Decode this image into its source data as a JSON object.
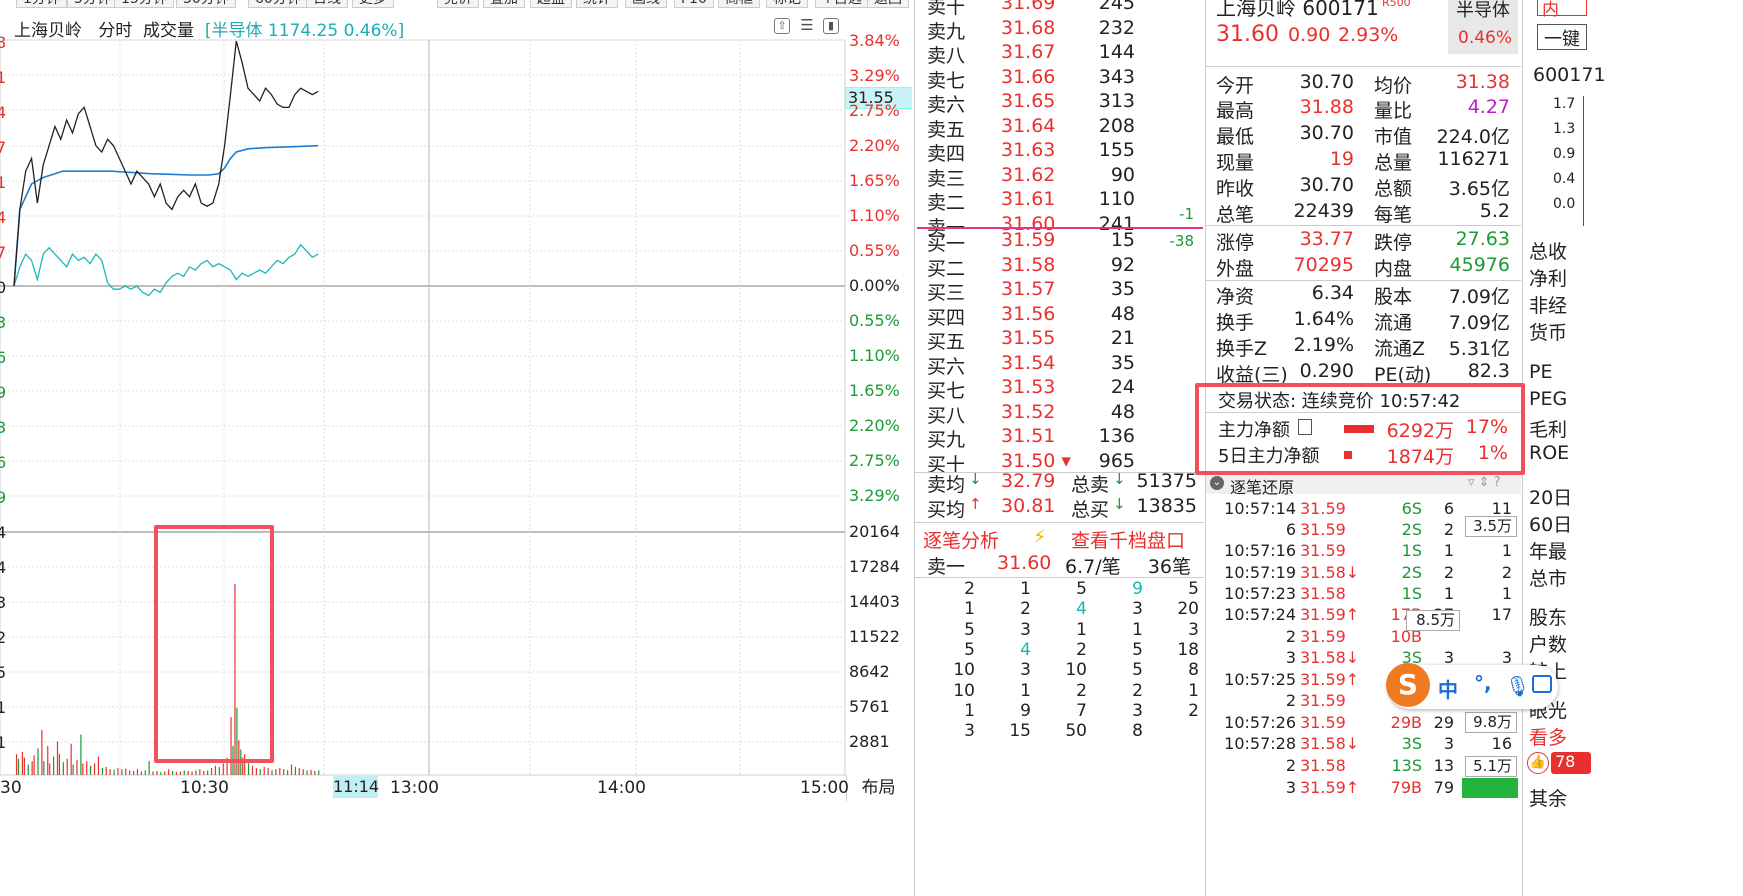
{
  "tabs": [
    "1分钟",
    "5分钟",
    "15分钟",
    "30分钟",
    "60分钟",
    "日线",
    "更多",
    "竞价",
    "叠加",
    "超盘",
    "统计",
    "画线",
    "F10",
    "商框",
    "标记",
    "+自选",
    "返回"
  ],
  "chart": {
    "stock_name": "上海贝岭",
    "mode": "分时",
    "indicator": "成交量",
    "sector_badge": "[半导体 1174.25 0.46%]",
    "left_axis": [
      "8",
      "1",
      "4",
      "7",
      "1",
      "4",
      "7",
      "0",
      "3",
      "6",
      "9",
      "3",
      "6",
      "9",
      "4",
      "4",
      "3",
      "2",
      "5",
      "1",
      "1"
    ],
    "pct_labels": [
      {
        "v": "3.84%",
        "c": "red"
      },
      {
        "v": "3.29%",
        "c": "red"
      },
      {
        "v": "2.75%",
        "c": "red"
      },
      {
        "v": "2.20%",
        "c": "red"
      },
      {
        "v": "1.65%",
        "c": "red"
      },
      {
        "v": "1.10%",
        "c": "red"
      },
      {
        "v": "0.55%",
        "c": "red"
      },
      {
        "v": "0.00%",
        "c": "dark"
      },
      {
        "v": "0.55%",
        "c": "green"
      },
      {
        "v": "1.10%",
        "c": "green"
      },
      {
        "v": "1.65%",
        "c": "green"
      },
      {
        "v": "2.20%",
        "c": "green"
      },
      {
        "v": "2.75%",
        "c": "green"
      },
      {
        "v": "3.29%",
        "c": "green"
      }
    ],
    "vol_labels": [
      "20164",
      "17284",
      "14403",
      "11522",
      "8642",
      "5761",
      "2881"
    ],
    "price_tag": "31.55",
    "time_labels": [
      "30",
      "10:30",
      "13:00",
      "14:00",
      "15:00"
    ],
    "cursor_time": "11:14",
    "layout_btn": "布局",
    "colors": {
      "price": "#222222",
      "avg": "#1a7fd4",
      "sector": "#1bb8b8",
      "up": "#e8312f",
      "down": "#1c9a36",
      "box": "#f0525d"
    },
    "price_series": [
      [
        0,
        0.0
      ],
      [
        3,
        1.2
      ],
      [
        6,
        1.8
      ],
      [
        9,
        2.0
      ],
      [
        12,
        1.3
      ],
      [
        15,
        1.9
      ],
      [
        18,
        2.2
      ],
      [
        21,
        2.5
      ],
      [
        24,
        2.3
      ],
      [
        27,
        2.6
      ],
      [
        30,
        2.4
      ],
      [
        33,
        2.7
      ],
      [
        36,
        2.8
      ],
      [
        39,
        2.5
      ],
      [
        42,
        2.2
      ],
      [
        45,
        2.1
      ],
      [
        48,
        2.3
      ],
      [
        51,
        2.2
      ],
      [
        54,
        2.0
      ],
      [
        57,
        1.8
      ],
      [
        60,
        1.6
      ],
      [
        63,
        1.8
      ],
      [
        66,
        1.7
      ],
      [
        69,
        1.6
      ],
      [
        72,
        1.4
      ],
      [
        75,
        1.6
      ],
      [
        78,
        1.3
      ],
      [
        81,
        1.2
      ],
      [
        84,
        1.4
      ],
      [
        87,
        1.5
      ],
      [
        90,
        1.4
      ],
      [
        93,
        1.6
      ],
      [
        96,
        1.3
      ],
      [
        99,
        1.25
      ],
      [
        102,
        1.3
      ],
      [
        105,
        1.6
      ],
      [
        108,
        2.2
      ],
      [
        111,
        3.0
      ],
      [
        114,
        3.84
      ],
      [
        117,
        3.5
      ],
      [
        120,
        3.1
      ],
      [
        123,
        3.0
      ],
      [
        126,
        2.9
      ],
      [
        129,
        3.1
      ],
      [
        132,
        3.0
      ],
      [
        135,
        2.85
      ],
      [
        138,
        2.8
      ],
      [
        141,
        2.8
      ],
      [
        144,
        3.0
      ],
      [
        147,
        3.1
      ],
      [
        150,
        3.05
      ],
      [
        153,
        3.0
      ],
      [
        156,
        3.05
      ]
    ],
    "avg_series": [
      [
        0,
        0.0
      ],
      [
        3,
        1.2
      ],
      [
        6,
        1.4
      ],
      [
        9,
        1.6
      ],
      [
        12,
        1.65
      ],
      [
        15,
        1.7
      ],
      [
        20,
        1.75
      ],
      [
        25,
        1.8
      ],
      [
        30,
        1.8
      ],
      [
        40,
        1.8
      ],
      [
        50,
        1.8
      ],
      [
        60,
        1.78
      ],
      [
        70,
        1.76
      ],
      [
        80,
        1.75
      ],
      [
        90,
        1.74
      ],
      [
        100,
        1.74
      ],
      [
        105,
        1.76
      ],
      [
        108,
        1.85
      ],
      [
        111,
        2.0
      ],
      [
        114,
        2.1
      ],
      [
        120,
        2.15
      ],
      [
        130,
        2.17
      ],
      [
        140,
        2.18
      ],
      [
        156,
        2.2
      ]
    ],
    "sector_series": [
      [
        0,
        0.0
      ],
      [
        3,
        0.3
      ],
      [
        6,
        0.5
      ],
      [
        9,
        0.4
      ],
      [
        12,
        0.1
      ],
      [
        15,
        0.5
      ],
      [
        18,
        0.6
      ],
      [
        21,
        0.5
      ],
      [
        24,
        0.4
      ],
      [
        27,
        0.3
      ],
      [
        30,
        0.5
      ],
      [
        33,
        0.4
      ],
      [
        36,
        0.45
      ],
      [
        39,
        0.35
      ],
      [
        42,
        0.5
      ],
      [
        45,
        0.4
      ],
      [
        48,
        0.05
      ],
      [
        51,
        -0.05
      ],
      [
        54,
        -0.05
      ],
      [
        57,
        0.0
      ],
      [
        60,
        -0.05
      ],
      [
        63,
        0.0
      ],
      [
        66,
        -0.1
      ],
      [
        69,
        -0.15
      ],
      [
        72,
        -0.05
      ],
      [
        75,
        -0.1
      ],
      [
        78,
        0.05
      ],
      [
        81,
        0.15
      ],
      [
        84,
        0.2
      ],
      [
        87,
        0.15
      ],
      [
        90,
        0.3
      ],
      [
        93,
        0.25
      ],
      [
        96,
        0.35
      ],
      [
        99,
        0.4
      ],
      [
        102,
        0.3
      ],
      [
        105,
        0.35
      ],
      [
        108,
        0.3
      ],
      [
        111,
        0.25
      ],
      [
        114,
        0.1
      ],
      [
        117,
        0.2
      ],
      [
        120,
        0.15
      ],
      [
        123,
        0.2
      ],
      [
        126,
        0.25
      ],
      [
        129,
        0.2
      ],
      [
        132,
        0.3
      ],
      [
        135,
        0.4
      ],
      [
        138,
        0.35
      ],
      [
        141,
        0.45
      ],
      [
        144,
        0.5
      ],
      [
        147,
        0.65
      ],
      [
        150,
        0.55
      ],
      [
        153,
        0.45
      ],
      [
        156,
        0.5
      ]
    ],
    "volume_bars": [
      [
        1,
        1800,
        1
      ],
      [
        2,
        1400,
        0
      ],
      [
        4,
        2000,
        1
      ],
      [
        5,
        1500,
        1
      ],
      [
        7,
        900,
        0
      ],
      [
        9,
        1200,
        1
      ],
      [
        10,
        1700,
        1
      ],
      [
        12,
        2300,
        0
      ],
      [
        14,
        3900,
        1
      ],
      [
        15,
        1200,
        0
      ],
      [
        17,
        2500,
        1
      ],
      [
        18,
        1000,
        1
      ],
      [
        20,
        1600,
        0
      ],
      [
        22,
        2900,
        1
      ],
      [
        23,
        1800,
        1
      ],
      [
        25,
        1100,
        0
      ],
      [
        27,
        1400,
        1
      ],
      [
        29,
        2700,
        1
      ],
      [
        30,
        900,
        0
      ],
      [
        32,
        1300,
        1
      ],
      [
        34,
        3500,
        0
      ],
      [
        35,
        1000,
        1
      ],
      [
        37,
        1200,
        1
      ],
      [
        39,
        800,
        0
      ],
      [
        41,
        1000,
        1
      ],
      [
        43,
        1600,
        1
      ],
      [
        45,
        600,
        0
      ],
      [
        47,
        700,
        1
      ],
      [
        49,
        500,
        1
      ],
      [
        51,
        450,
        0
      ],
      [
        53,
        600,
        1
      ],
      [
        55,
        500,
        0
      ],
      [
        57,
        550,
        1
      ],
      [
        59,
        400,
        1
      ],
      [
        61,
        350,
        0
      ],
      [
        63,
        500,
        1
      ],
      [
        65,
        300,
        1
      ],
      [
        67,
        400,
        0
      ],
      [
        69,
        1200,
        0
      ],
      [
        71,
        300,
        1
      ],
      [
        73,
        350,
        1
      ],
      [
        75,
        250,
        0
      ],
      [
        77,
        300,
        1
      ],
      [
        79,
        500,
        1
      ],
      [
        81,
        350,
        0
      ],
      [
        83,
        250,
        1
      ],
      [
        85,
        300,
        1
      ],
      [
        87,
        400,
        0
      ],
      [
        89,
        350,
        1
      ],
      [
        91,
        300,
        1
      ],
      [
        93,
        400,
        0
      ],
      [
        95,
        500,
        1
      ],
      [
        97,
        350,
        1
      ],
      [
        99,
        400,
        0
      ],
      [
        101,
        600,
        1
      ],
      [
        103,
        800,
        1
      ],
      [
        105,
        700,
        0
      ],
      [
        107,
        1000,
        1
      ],
      [
        109,
        1500,
        1
      ],
      [
        111,
        5000,
        1
      ],
      [
        112,
        2500,
        0
      ],
      [
        113,
        16500,
        1
      ],
      [
        114,
        5800,
        0
      ],
      [
        115,
        3000,
        1
      ],
      [
        116,
        2200,
        0
      ],
      [
        117,
        1500,
        1
      ],
      [
        118,
        1800,
        1
      ],
      [
        120,
        1000,
        0
      ],
      [
        122,
        800,
        1
      ],
      [
        124,
        600,
        1
      ],
      [
        126,
        500,
        0
      ],
      [
        128,
        700,
        1
      ],
      [
        130,
        600,
        1
      ],
      [
        132,
        400,
        0
      ],
      [
        134,
        500,
        1
      ],
      [
        136,
        600,
        1
      ],
      [
        138,
        500,
        0
      ],
      [
        140,
        400,
        1
      ],
      [
        142,
        900,
        1
      ],
      [
        144,
        700,
        0
      ],
      [
        146,
        600,
        1
      ],
      [
        148,
        500,
        1
      ],
      [
        150,
        400,
        0
      ],
      [
        152,
        450,
        1
      ],
      [
        154,
        350,
        1
      ],
      [
        156,
        400,
        0
      ]
    ]
  },
  "orderbook": {
    "sell": [
      [
        "卖十",
        "31.69",
        "245"
      ],
      [
        "卖九",
        "31.68",
        "232"
      ],
      [
        "卖八",
        "31.67",
        "144"
      ],
      [
        "卖七",
        "31.66",
        "343"
      ],
      [
        "卖六",
        "31.65",
        "313"
      ],
      [
        "卖五",
        "31.64",
        "208"
      ],
      [
        "卖四",
        "31.63",
        "155"
      ],
      [
        "卖三",
        "31.62",
        "90"
      ],
      [
        "卖二",
        "31.61",
        "110"
      ],
      [
        "卖一",
        "31.60",
        "241"
      ]
    ],
    "sell1_delta": "-1",
    "buy": [
      [
        "买一",
        "31.59",
        "15"
      ],
      [
        "买二",
        "31.58",
        "92"
      ],
      [
        "买三",
        "31.57",
        "35"
      ],
      [
        "买四",
        "31.56",
        "48"
      ],
      [
        "买五",
        "31.55",
        "21"
      ],
      [
        "买六",
        "31.54",
        "35"
      ],
      [
        "买七",
        "31.53",
        "24"
      ],
      [
        "买八",
        "31.52",
        "48"
      ],
      [
        "买九",
        "31.51",
        "136"
      ],
      [
        "买十",
        "31.50",
        "965"
      ]
    ],
    "buy1_delta": "-38",
    "sell_avg_label": "卖均",
    "sell_avg": "32.79",
    "total_sell_label": "总卖",
    "total_sell": "51375",
    "buy_avg_label": "买均",
    "buy_avg": "30.81",
    "total_buy_label": "总买",
    "total_buy": "13835",
    "tick_analysis": "逐笔分析",
    "view_depth": "查看千档盘口",
    "queue_label": "卖一",
    "queue_price": "31.60",
    "queue_per": "6.7/笔",
    "queue_count": "36笔",
    "queue": [
      [
        "2",
        "1",
        "5",
        "9",
        "5"
      ],
      [
        "1",
        "2",
        "4",
        "3",
        "20"
      ],
      [
        "5",
        "3",
        "1",
        "1",
        "3"
      ],
      [
        "5",
        "4",
        "2",
        "5",
        "18"
      ],
      [
        "10",
        "3",
        "10",
        "5",
        "8"
      ],
      [
        "10",
        "1",
        "2",
        "2",
        "1"
      ],
      [
        "1",
        "9",
        "7",
        "3",
        "2"
      ],
      [
        "3",
        "15",
        "50",
        "8",
        ""
      ]
    ]
  },
  "quote": {
    "name": "上海贝岭 600171",
    "r_badge": "R500",
    "price": "31.60",
    "change": "0.90",
    "pct": "2.93%",
    "sector": "半导体",
    "sector_pct": "0.46%",
    "rows": [
      [
        [
          "今开",
          "dark"
        ],
        [
          "30.70",
          "dark"
        ],
        [
          "均价",
          "dark"
        ],
        [
          "31.38",
          "red"
        ]
      ],
      [
        [
          "最高",
          "dark"
        ],
        [
          "31.88",
          "red"
        ],
        [
          "量比",
          "dark"
        ],
        [
          "4.27",
          "mag"
        ]
      ],
      [
        [
          "最低",
          "dark"
        ],
        [
          "30.70",
          "dark"
        ],
        [
          "市值",
          "dark"
        ],
        [
          "224.0亿",
          "dark"
        ]
      ],
      [
        [
          "现量",
          "dark"
        ],
        [
          "19",
          "red"
        ],
        [
          "总量",
          "dark"
        ],
        [
          "116271",
          "dark"
        ]
      ],
      [
        [
          "昨收",
          "dark"
        ],
        [
          "30.70",
          "dark"
        ],
        [
          "总额",
          "dark"
        ],
        [
          "3.65亿",
          "dark"
        ]
      ],
      [
        [
          "总笔",
          "dark"
        ],
        [
          "22439",
          "dark"
        ],
        [
          "每笔",
          "dark"
        ],
        [
          "5.2",
          "dark"
        ]
      ],
      [
        [
          "涨停",
          "dark"
        ],
        [
          "33.77",
          "red"
        ],
        [
          "跌停",
          "dark"
        ],
        [
          "27.63",
          "green"
        ]
      ],
      [
        [
          "外盘",
          "dark"
        ],
        [
          "70295",
          "red"
        ],
        [
          "内盘",
          "dark"
        ],
        [
          "45976",
          "green"
        ]
      ],
      [
        [
          "净资",
          "dark"
        ],
        [
          "6.34",
          "dark"
        ],
        [
          "股本",
          "dark"
        ],
        [
          "7.09亿",
          "dark"
        ]
      ],
      [
        [
          "换手",
          "dark"
        ],
        [
          "1.64%",
          "dark"
        ],
        [
          "流通",
          "dark"
        ],
        [
          "7.09亿",
          "dark"
        ]
      ],
      [
        [
          "换手Z",
          "dark"
        ],
        [
          "2.19%",
          "dark"
        ],
        [
          "流通Z",
          "dark"
        ],
        [
          "5.31亿",
          "dark"
        ]
      ],
      [
        [
          "收益(三)",
          "dark"
        ],
        [
          "0.290",
          "dark"
        ],
        [
          "PE(动)",
          "dark"
        ],
        [
          "82.3",
          "dark"
        ]
      ]
    ],
    "trade_status": "交易状态: 连续竞价 10:57:42",
    "main_net_label": "主力净额",
    "main_net": "6292万",
    "main_net_pct": "17%",
    "main5_label": "5日主力净额",
    "main5": "1874万",
    "main5_pct": "1%",
    "tick_title": "逐笔还原",
    "ticks": [
      [
        "10:57:14",
        "31.59",
        "6S",
        "6",
        "11"
      ],
      [
        "6",
        "31.59",
        "2S",
        "2",
        ""
      ],
      [
        "10:57:16",
        "31.59",
        "1S",
        "1",
        "1"
      ],
      [
        "10:57:19",
        "31.58↓",
        "2S",
        "2",
        "2"
      ],
      [
        "10:57:23",
        "31.58",
        "1S",
        "1",
        "1"
      ],
      [
        "10:57:24",
        "31.59↑",
        "17B",
        "27",
        "17"
      ],
      [
        "2",
        "31.59",
        "10B",
        "",
        ""
      ],
      [
        "3",
        "31.58↓",
        "3S",
        "3",
        "3"
      ],
      [
        "10:57:25",
        "31.59↑",
        "2B",
        "",
        ""
      ],
      [
        "2",
        "31.59",
        "2B",
        "",
        ""
      ],
      [
        "10:57:26",
        "31.59",
        "29B",
        "29",
        ""
      ],
      [
        "10:57:28",
        "31.58↓",
        "3S",
        "3",
        "16"
      ],
      [
        "2",
        "31.58",
        "13S",
        "13",
        ""
      ],
      [
        "3",
        "31.59↑",
        "79B",
        "79",
        "160"
      ]
    ],
    "vol_tags": [
      "3.5万",
      "8.5万",
      "9.8万",
      "5.1万"
    ]
  },
  "right": {
    "btn_top": "内",
    "btn_second": "一键",
    "code": "600171",
    "nums": [
      "1.7",
      "1.3",
      "0.9",
      "0.4",
      "0.0"
    ],
    "labels": [
      "总收",
      "净利",
      "非经",
      "货币"
    ],
    "labels2": [
      "PE",
      "PEG",
      "毛利",
      "ROE"
    ],
    "labels3": [
      "20日",
      "60日",
      "年最",
      "总市"
    ],
    "labels4": [
      "股东",
      "户数",
      "较上"
    ],
    "labels5": [
      "眼光",
      "看多"
    ],
    "like_count": "78",
    "bottom": "其余"
  },
  "ime": {
    "icon": "S",
    "lang": "中",
    "punct": "°,"
  }
}
